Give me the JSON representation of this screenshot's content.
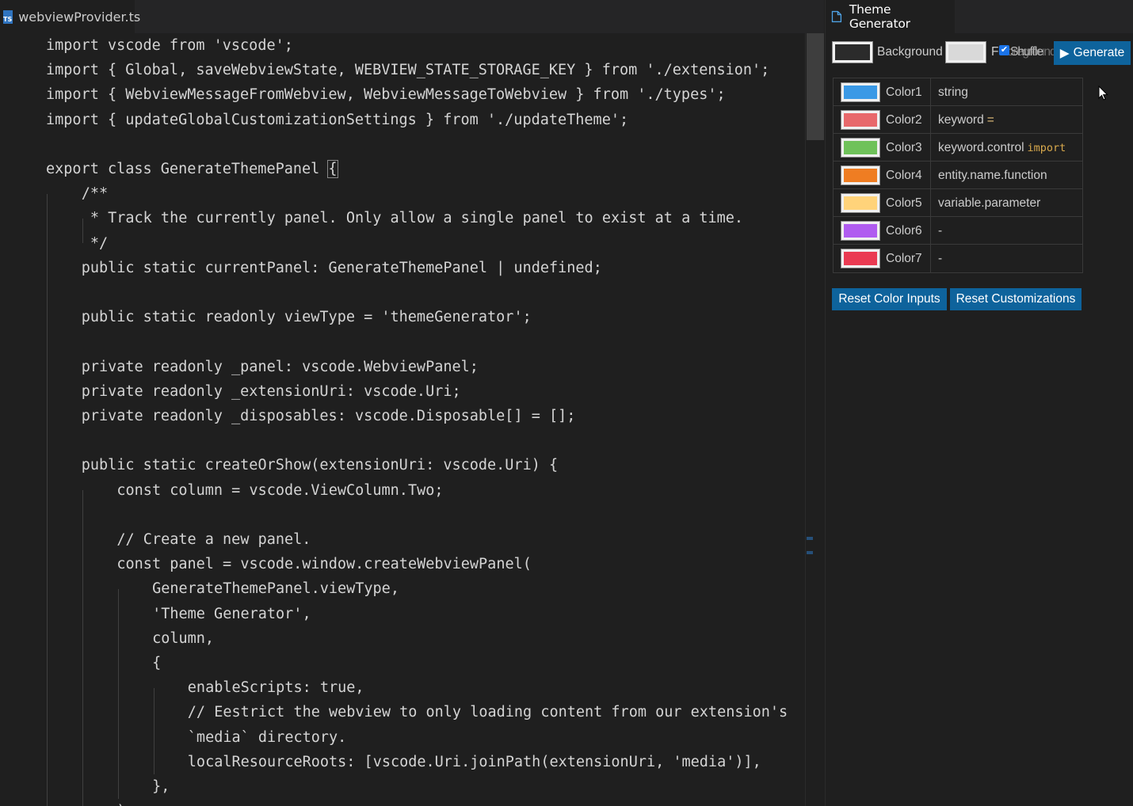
{
  "editor": {
    "tab": {
      "icon": "typescript-file-icon",
      "icon_text": "TS",
      "filename": "webviewProvider.ts"
    },
    "lines": [
      {
        "indent": 0,
        "row": 0,
        "tokens": [
          [
            "import vscode from ",
            "#d4d4d4"
          ],
          [
            "'vscode'",
            "#d4d4d4"
          ],
          [
            ";",
            "#d4d4d4"
          ]
        ]
      },
      {
        "indent": 0,
        "row": 1,
        "tokens": [
          [
            "import { Global, saveWebviewState, WEBVIEW_STATE_STORAGE_KEY } from './extension';",
            "#d4d4d4"
          ]
        ]
      },
      {
        "indent": 0,
        "row": 2,
        "tokens": [
          [
            "import { WebviewMessageFromWebview, WebviewMessageToWebview } from './types';",
            "#d4d4d4"
          ]
        ]
      },
      {
        "indent": 0,
        "row": 3,
        "tokens": [
          [
            "import { updateGlobalCustomizationSettings } from './updateTheme';",
            "#d4d4d4"
          ]
        ]
      },
      {
        "indent": 0,
        "row": 5,
        "tokens": [
          [
            "export class GenerateThemePanel ",
            "#d4d4d4"
          ],
          [
            "{",
            "#d4d4d4",
            "box"
          ]
        ]
      },
      {
        "indent": 1,
        "row": 6,
        "tokens": [
          [
            "/**",
            "#d4d4d4"
          ]
        ]
      },
      {
        "indent": 1,
        "row": 7,
        "tokens": [
          [
            " * Track the currently panel. Only allow a single panel to exist at a time.",
            "#d4d4d4"
          ]
        ]
      },
      {
        "indent": 1,
        "row": 8,
        "tokens": [
          [
            " */",
            "#d4d4d4"
          ]
        ]
      },
      {
        "indent": 1,
        "row": 9,
        "tokens": [
          [
            "public static currentPanel: GenerateThemePanel | undefined;",
            "#d4d4d4"
          ]
        ]
      },
      {
        "indent": 1,
        "row": 11,
        "tokens": [
          [
            "public static readonly viewType = 'themeGenerator';",
            "#d4d4d4"
          ]
        ]
      },
      {
        "indent": 1,
        "row": 13,
        "tokens": [
          [
            "private readonly _panel: vscode.WebviewPanel;",
            "#d4d4d4"
          ]
        ]
      },
      {
        "indent": 1,
        "row": 14,
        "tokens": [
          [
            "private readonly _extensionUri: vscode.Uri;",
            "#d4d4d4"
          ]
        ]
      },
      {
        "indent": 1,
        "row": 15,
        "tokens": [
          [
            "private readonly _disposables: vscode.Disposable[] = [];",
            "#d4d4d4"
          ]
        ]
      },
      {
        "indent": 1,
        "row": 17,
        "tokens": [
          [
            "public static createOrShow(extensionUri: vscode.Uri) {",
            "#d4d4d4"
          ]
        ]
      },
      {
        "indent": 2,
        "row": 18,
        "tokens": [
          [
            "const column = vscode.ViewColumn.Two;",
            "#d4d4d4"
          ]
        ]
      },
      {
        "indent": 2,
        "row": 20,
        "tokens": [
          [
            "// Create a new panel.",
            "#d4d4d4"
          ]
        ]
      },
      {
        "indent": 2,
        "row": 21,
        "tokens": [
          [
            "const panel = vscode.window.createWebviewPanel(",
            "#d4d4d4"
          ]
        ]
      },
      {
        "indent": 3,
        "row": 22,
        "tokens": [
          [
            "GenerateThemePanel.viewType,",
            "#d4d4d4"
          ]
        ]
      },
      {
        "indent": 3,
        "row": 23,
        "tokens": [
          [
            "'Theme Generator',",
            "#d4d4d4"
          ]
        ]
      },
      {
        "indent": 3,
        "row": 24,
        "tokens": [
          [
            "column,",
            "#d4d4d4"
          ]
        ]
      },
      {
        "indent": 3,
        "row": 25,
        "tokens": [
          [
            "{",
            "#d4d4d4"
          ]
        ]
      },
      {
        "indent": 4,
        "row": 26,
        "tokens": [
          [
            "enableScripts: true,",
            "#d4d4d4"
          ]
        ]
      },
      {
        "indent": 4,
        "row": 27,
        "tokens": [
          [
            "// Eestrict the webview to only loading content from our extension's",
            "#d4d4d4"
          ]
        ]
      },
      {
        "indent": 4,
        "row": 28,
        "tokens": [
          [
            "`media` directory.",
            "#d4d4d4"
          ]
        ]
      },
      {
        "indent": 4,
        "row": 29,
        "tokens": [
          [
            "localResourceRoots: [vscode.Uri.joinPath(extensionUri, 'media')],",
            "#d4d4d4"
          ]
        ]
      },
      {
        "indent": 3,
        "row": 30,
        "tokens": [
          [
            "},",
            "#d4d4d4"
          ]
        ]
      },
      {
        "indent": 2,
        "row": 31,
        "tokens": [
          [
            ");",
            "#d4d4d4"
          ]
        ]
      }
    ]
  },
  "panel": {
    "tab": {
      "icon": "file-icon",
      "title": "Theme Generator"
    },
    "toolbar": {
      "background_label": "Background",
      "background_color": "#2b2b2b",
      "foreground_label": "Foreground",
      "foreground_label_visible": "F",
      "foreground_color": "#d9d9d9",
      "shuffle_label": "Shuffle",
      "shuffle_checked": true,
      "generate_label": "Generate",
      "generate_icon": "play-icon"
    },
    "colors": [
      {
        "name": "Color1",
        "color": "#3a99e6",
        "scope": "string",
        "extra": "",
        "extra_color": ""
      },
      {
        "name": "Color2",
        "color": "#e8686b",
        "scope": "keyword",
        "extra": "=",
        "extra_color": "#e5c07b"
      },
      {
        "name": "Color3",
        "color": "#6fc25a",
        "scope": "keyword.control",
        "extra": "import",
        "extra_color": "#d7a84c"
      },
      {
        "name": "Color4",
        "color": "#ef7d22",
        "scope": "entity.name.function",
        "extra": "",
        "extra_color": ""
      },
      {
        "name": "Color5",
        "color": "#ffd37a",
        "scope": "variable.parameter",
        "extra": "",
        "extra_color": ""
      },
      {
        "name": "Color6",
        "color": "#b05cf0",
        "scope": "-",
        "extra": "",
        "extra_color": ""
      },
      {
        "name": "Color7",
        "color": "#ea3b52",
        "scope": "-",
        "extra": "",
        "extra_color": ""
      }
    ],
    "reset_color_inputs_label": "Reset Color Inputs",
    "reset_customizations_label": "Reset Customizations"
  }
}
